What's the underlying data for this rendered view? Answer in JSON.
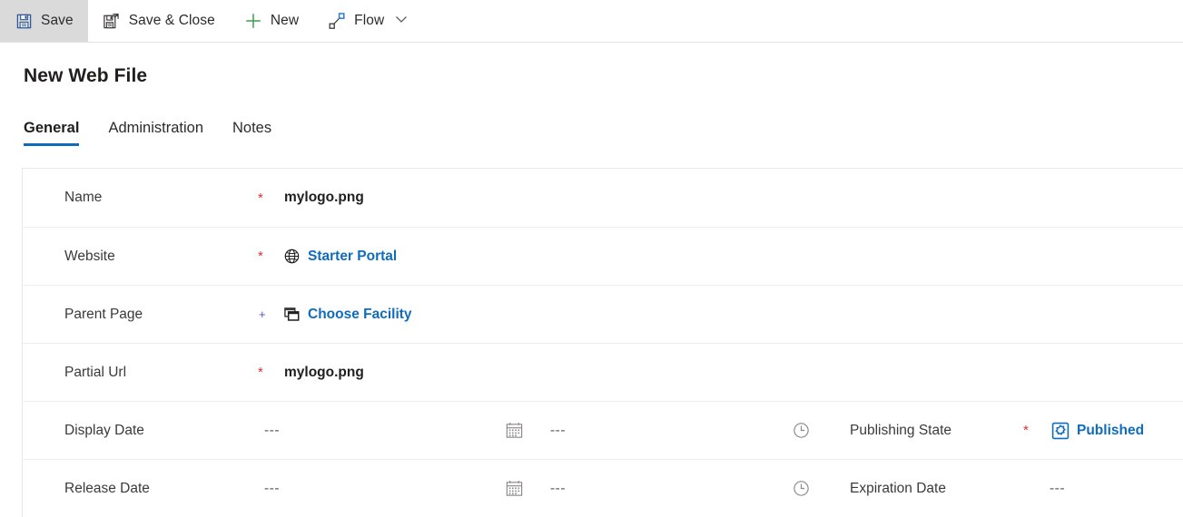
{
  "command_bar": {
    "buttons": [
      {
        "label": "Save",
        "icon": "save-icon",
        "active": true
      },
      {
        "label": "Save & Close",
        "icon": "save-and-close-icon",
        "active": false
      },
      {
        "label": "New",
        "icon": "plus-icon",
        "active": false
      },
      {
        "label": "Flow",
        "icon": "flow-icon",
        "active": false
      }
    ],
    "overflow_caret": "chevron-down-icon"
  },
  "header": {
    "title": "New Web File"
  },
  "tabs": [
    {
      "label": "General",
      "active": true
    },
    {
      "label": "Administration",
      "active": false
    },
    {
      "label": "Notes",
      "active": false
    }
  ],
  "form": {
    "rows": [
      {
        "label": "Name",
        "required_mark": "*",
        "required_kind": "required",
        "value": "mylogo.png",
        "value_kind": "text"
      },
      {
        "label": "Website",
        "required_mark": "*",
        "required_kind": "required",
        "value": "Starter Portal",
        "value_kind": "lookup",
        "icon": "globe-icon"
      },
      {
        "label": "Parent Page",
        "required_mark": "+",
        "required_kind": "recommended",
        "value": "Choose Facility",
        "value_kind": "lookup",
        "icon": "pages-icon"
      },
      {
        "label": "Partial Url",
        "required_mark": "*",
        "required_kind": "required",
        "value": "mylogo.png",
        "value_kind": "text"
      },
      {
        "label": "Display Date",
        "date_value": "---",
        "date_icon": "calendar-icon",
        "time_value": "---",
        "time_icon": "clock-icon",
        "right_label": "Publishing State",
        "right_required_mark": "*",
        "right_value": "Published",
        "right_value_kind": "lookup",
        "right_icon": "entity-published-icon"
      },
      {
        "label": "Release Date",
        "date_value": "---",
        "date_icon": "calendar-icon",
        "time_value": "---",
        "time_icon": "clock-icon",
        "right_label": "Expiration Date",
        "right_value": "---",
        "right_value_kind": "placeholder"
      }
    ]
  },
  "colors": {
    "link": "#0f6cbd",
    "required": "#d13438",
    "recommended": "#4f52c9",
    "tab_underline": "#0f6cbd",
    "new_icon_green": "#3f9c52",
    "save_icon_blue": "#2b579a",
    "active_button_bg": "#dadada"
  }
}
